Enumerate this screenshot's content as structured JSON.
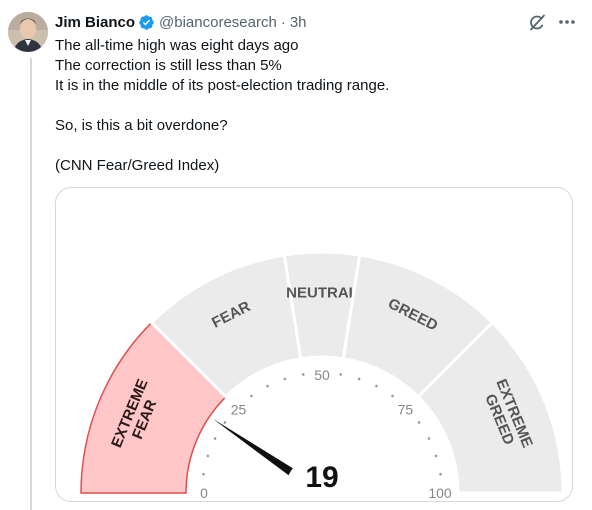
{
  "tweet": {
    "author_name": "Jim Bianco",
    "handle": "@biancoresearch",
    "separator": "·",
    "time": "3h",
    "lines": [
      "The all-time high was eight days ago",
      "The correction is still less than 5%",
      "It is in the middle of its post-election trading range.",
      "",
      "So, is this a bit overdone?",
      "",
      "(CNN Fear/Greed Index)"
    ]
  },
  "icons": {
    "verified": "verified-badge-icon",
    "grok": "grok-icon",
    "more": "more-options-icon"
  },
  "colors": {
    "verified_blue": "#1d9bf0",
    "segment_gray": "#ebebeb",
    "active_segment": "#ffc7c7",
    "active_border": "#e04f4f",
    "needle": "#0f0f0f"
  },
  "gauge": {
    "zones": [
      {
        "label": "EXTREME FEAR",
        "lines": [
          "EXTREME",
          "FEAR"
        ],
        "from": 0,
        "to": 25,
        "active": true
      },
      {
        "label": "FEAR",
        "lines": [
          "FEAR"
        ],
        "from": 25,
        "to": 45,
        "active": false
      },
      {
        "label": "NEUTRAL",
        "lines": [
          "NEUTRAL"
        ],
        "from": 45,
        "to": 55,
        "active": false
      },
      {
        "label": "GREED",
        "lines": [
          "GREED"
        ],
        "from": 55,
        "to": 75,
        "active": false
      },
      {
        "label": "EXTREME GREED",
        "lines": [
          "EXTREME",
          "GREED"
        ],
        "from": 75,
        "to": 100,
        "active": false
      }
    ],
    "ticks": [
      {
        "value": 0,
        "label": "0"
      },
      {
        "value": 25,
        "label": "25"
      },
      {
        "value": 50,
        "label": "50"
      },
      {
        "value": 75,
        "label": "75"
      },
      {
        "value": 100,
        "label": "100"
      }
    ],
    "value": 19,
    "value_label": "19"
  }
}
